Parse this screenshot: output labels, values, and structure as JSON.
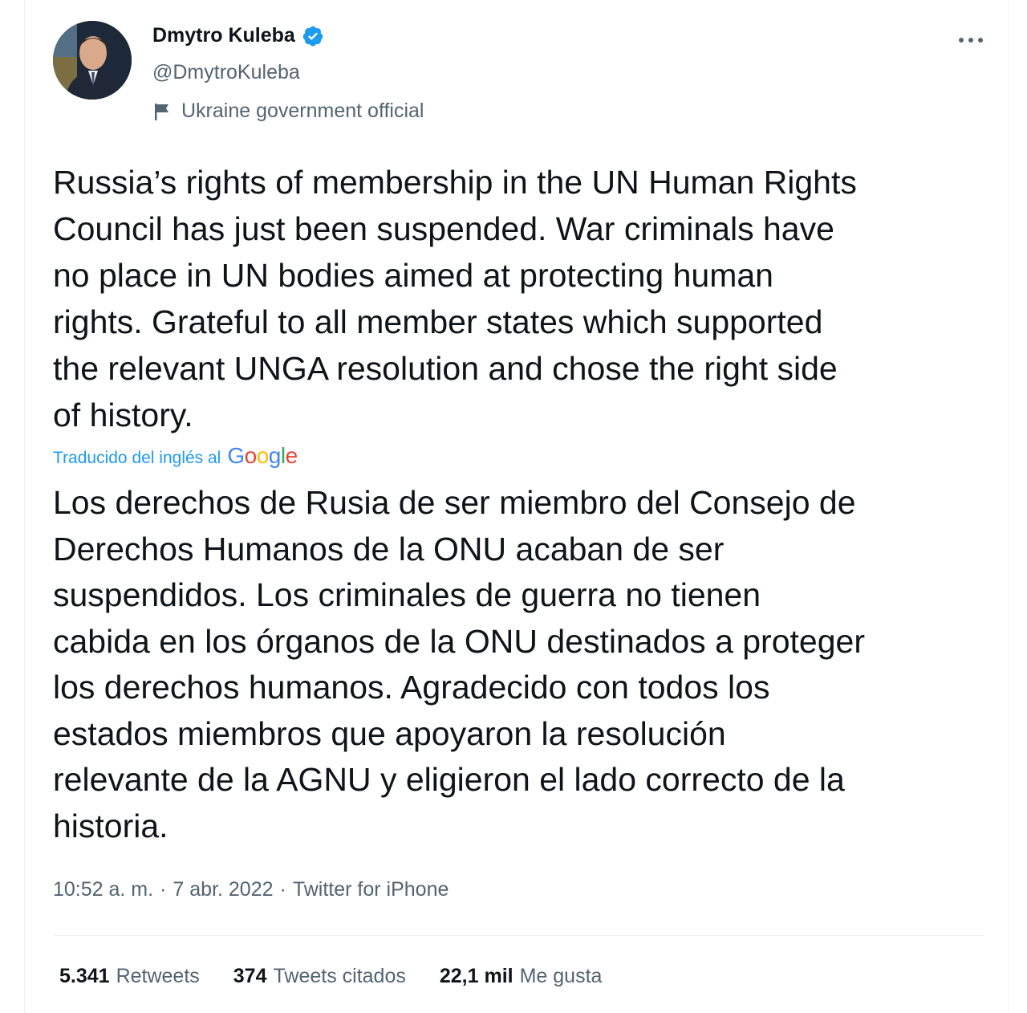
{
  "author": {
    "name": "Dmytro Kuleba",
    "handle": "@DmytroKuleba",
    "label": "Ukraine government official"
  },
  "tweet": {
    "text": "Russia’s rights of membership in the UN Human Rights\nCouncil has just been suspended. War criminals have\nno place in UN bodies aimed at protecting human\nrights. Grateful to all member states which supported\nthe relevant UNGA resolution and chose the right side\nof history.",
    "translated_label": "Traducido del inglés al",
    "translator": "Google",
    "translation": "Los derechos de Rusia de ser miembro del Consejo de\nDerechos Humanos de la ONU acaban de ser\nsuspendidos. Los criminales de guerra no tienen\ncabida en los órganos de la ONU destinados a proteger\nlos derechos humanos. Agradecido con todos los\nestados miembros que apoyaron la resolución\nrelevante de la AGNU y eligieron el lado correcto de la\nhistoria."
  },
  "meta": {
    "time": "10:52 a. m.",
    "sep1": "·",
    "date": "7 abr. 2022",
    "sep2": "·",
    "source": "Twitter for iPhone"
  },
  "stats": [
    {
      "value": "5.341",
      "label": "Retweets"
    },
    {
      "value": "374",
      "label": "Tweets citados"
    },
    {
      "value": "22,1 mil",
      "label": "Me gusta"
    }
  ],
  "icons": {
    "verified": "verified-badge-icon",
    "flag": "flag-icon",
    "more": "more-options-icon"
  },
  "colors": {
    "accent": "#1d9bf0",
    "secondary_text": "#536471",
    "primary_text": "#0f1419"
  }
}
